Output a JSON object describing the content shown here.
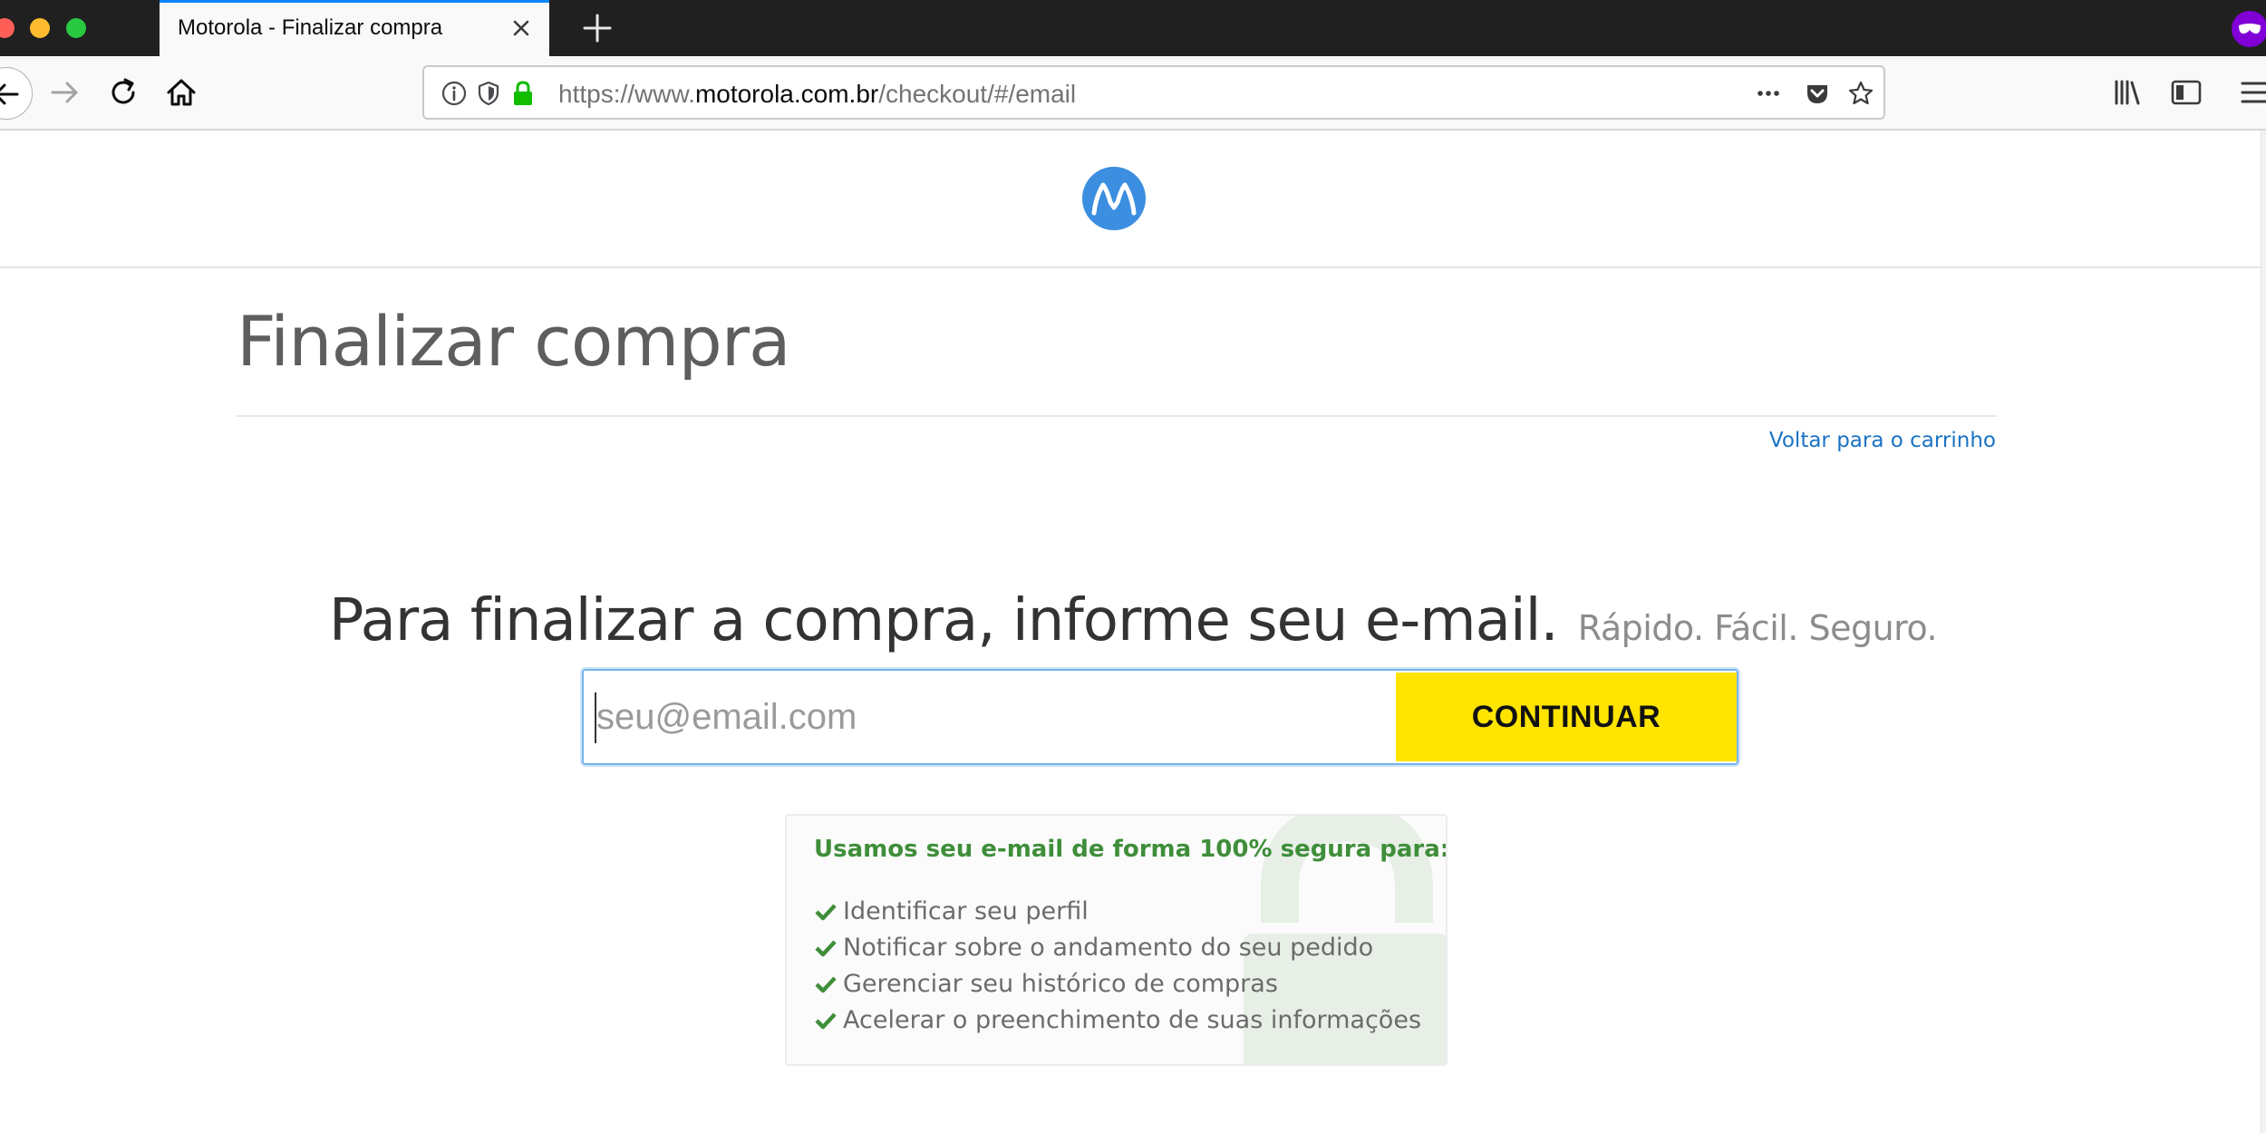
{
  "browser": {
    "tab_title": "Motorola - Finalizar compra",
    "url_prefix": "https://www.",
    "url_domain": "motorola.com.br",
    "url_path": "/checkout/#/email"
  },
  "page": {
    "title": "Finalizar compra",
    "back_link": "Voltar para o carrinho",
    "headline": "Para finalizar a compra, informe seu e-mail.",
    "tagline": "Rápido. Fácil. Seguro.",
    "email_placeholder": "seu@email.com",
    "email_value": "",
    "continue_label": "CONTINUAR"
  },
  "info": {
    "title": "Usamos seu e-mail de forma 100% segura para:",
    "items": [
      "Identificar seu perfil",
      "Notificar sobre o andamento do seu pedido",
      "Gerenciar seu histórico de compras",
      "Acelerar o preenchimento de suas informações"
    ]
  },
  "colors": {
    "accent_yellow": "#ffe400",
    "link_blue": "#1a73c4",
    "success_green": "#3f8e3a",
    "logo_blue": "#3c8ee0"
  },
  "icons": {
    "site_logo": "motorola-logo",
    "list_bullet": "checkmark-icon",
    "info_watermark": "padlock-icon"
  }
}
